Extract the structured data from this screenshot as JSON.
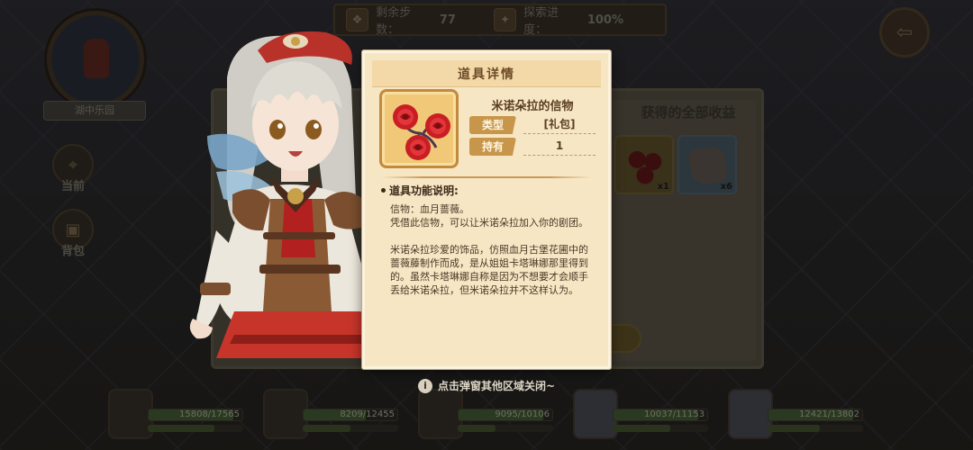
{
  "background": {
    "topbar": {
      "steps_label": "剩余步数：",
      "steps_value": "77",
      "explore_label": "探索进度：",
      "explore_value": "100%"
    },
    "scene_label": "湖中乐园",
    "side_buttons": [
      {
        "label": "当前",
        "icon": "map-pin-icon"
      },
      {
        "label": "背包",
        "icon": "backpack-icon"
      }
    ],
    "rewards_panel": {
      "title": "获得的全部收益",
      "items": [
        {
          "name": "rose-item",
          "count": "x1"
        },
        {
          "name": "stone-item",
          "count": "x6"
        }
      ]
    },
    "roster": [
      {
        "hp": "15808/17565",
        "hp_fraction": 0.9,
        "sub_fraction": 0.7
      },
      {
        "hp": "8209/12455",
        "hp_fraction": 0.66,
        "sub_fraction": 0.5
      },
      {
        "hp": "9095/10106",
        "hp_fraction": 0.9,
        "sub_fraction": 0.4
      },
      {
        "hp": "10037/11153",
        "hp_fraction": 0.9,
        "sub_fraction": 0.6
      },
      {
        "hp": "12421/13802",
        "hp_fraction": 0.9,
        "sub_fraction": 0.55
      }
    ]
  },
  "modal": {
    "title": "道具详情",
    "item_name": "米诺朵拉的信物",
    "item_icon": "red-roses-icon",
    "type_label": "类型",
    "type_value": "[礼包]",
    "owned_label": "持有",
    "owned_value": "1",
    "section_title": "道具功能说明:",
    "paragraphs": [
      "信物：血月蔷薇。\n凭借此信物，可以让米诺朵拉加入你的剧团。",
      "米诺朵拉珍爱的饰品，仿照血月古堡花圃中的蔷薇藤制作而成，是从姐姐卡塔琳娜那里得到的。虽然卡塔琳娜自称是因为不想要才会顺手丢给米诺朵拉，但米诺朵拉并不这样认为。"
    ]
  },
  "footer_hint": "点击弹窗其他区域关闭~",
  "colors": {
    "modal_bg": "#f7e6c4",
    "label_gold": "#c7964a",
    "rose_red": "#d8202a"
  }
}
